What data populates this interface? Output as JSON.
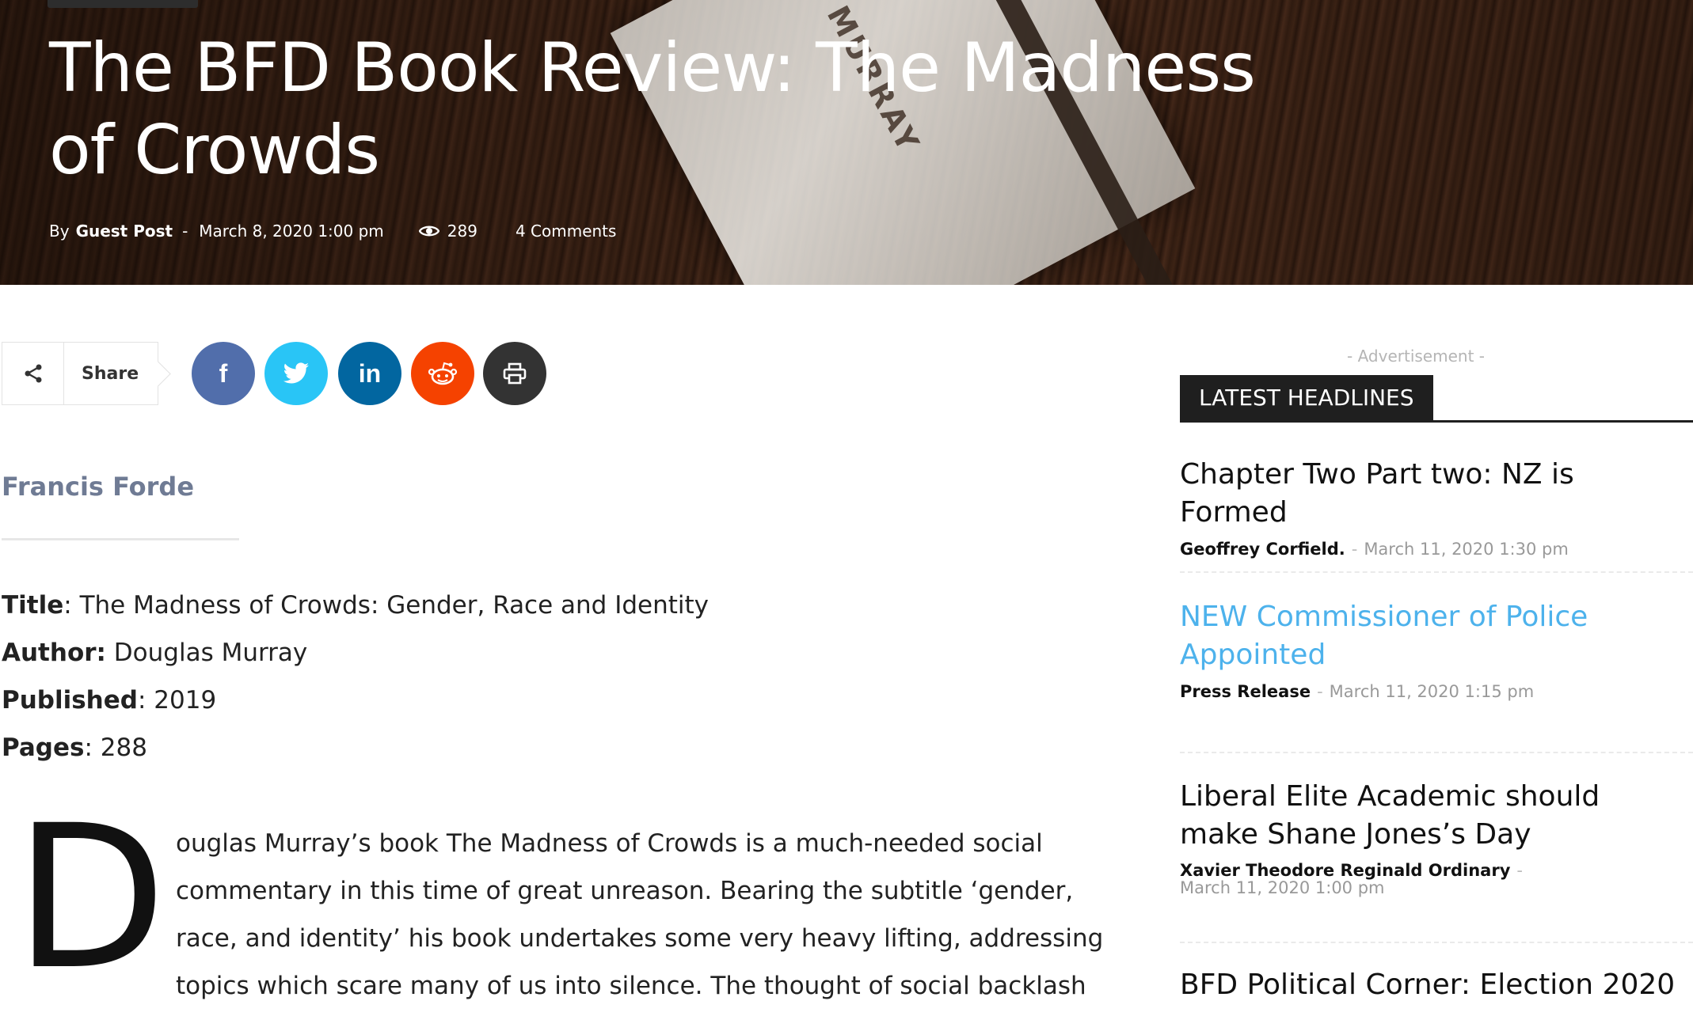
{
  "hero": {
    "title": "The BFD Book Review: The Madness of Crowds",
    "by_label": "By",
    "author": "Guest Post",
    "dash": "-",
    "date": "March 8, 2020 1:00 pm",
    "views": "289",
    "comments": "4 Comments",
    "book_spine_text": "LAS MURRAY"
  },
  "share": {
    "label": "Share",
    "buttons": [
      {
        "name": "facebook",
        "glyph": "f",
        "color": "#516eab"
      },
      {
        "name": "twitter",
        "glyph": "twitter-bird",
        "color": "#29c5f6"
      },
      {
        "name": "linkedin",
        "glyph": "in",
        "color": "#0266a0"
      },
      {
        "name": "reddit",
        "glyph": "reddit-alien",
        "color": "#f54200"
      },
      {
        "name": "print",
        "glyph": "printer",
        "color": "#333333"
      }
    ]
  },
  "article": {
    "author_name": "Francis Forde",
    "info": [
      {
        "label": "Title",
        "sep": ": ",
        "value": "The Madness of Crowds: Gender, Race and Identity"
      },
      {
        "label": "Author:",
        "sep": " ",
        "value": "Douglas Murray"
      },
      {
        "label": "Published",
        "sep": ": ",
        "value": "2019"
      },
      {
        "label": "Pages",
        "sep": ": ",
        "value": "288"
      }
    ],
    "dropcap": "D",
    "lead": "ouglas Murray’s book The Madness of Crowds is a much-needed social commentary in this time of great unreason. Bearing the subtitle ‘gender, race, and identity’ his book undertakes some very heavy lifting, addressing topics which scare many of us into silence. The thought of social backlash by"
  },
  "sidebar": {
    "advertisement": "- Advertisement -",
    "heading": "LATEST HEADLINES",
    "items": [
      {
        "title": "Chapter Two Part two: NZ is Formed",
        "author": "Geoffrey Corfield.",
        "sep": "-",
        "date": "March 11, 2020 1:30 pm"
      },
      {
        "title": "NEW Commissioner of Police Appointed",
        "author": "Press Release",
        "sep": "-",
        "date": "March 11, 2020 1:15 pm"
      },
      {
        "title": "Liberal Elite Academic should make Shane Jones’s Day",
        "author": "Xavier Theodore Reginald Ordinary",
        "sep": "-",
        "date": "March 11, 2020 1:00 pm"
      },
      {
        "title": "BFD Political Corner: Election 2020",
        "author": "",
        "sep": "",
        "date": ""
      }
    ]
  },
  "colors": {
    "link_blue": "#4db2ec",
    "byline_gray": "#6f7b94",
    "heading_bg": "#1f1f1f"
  }
}
